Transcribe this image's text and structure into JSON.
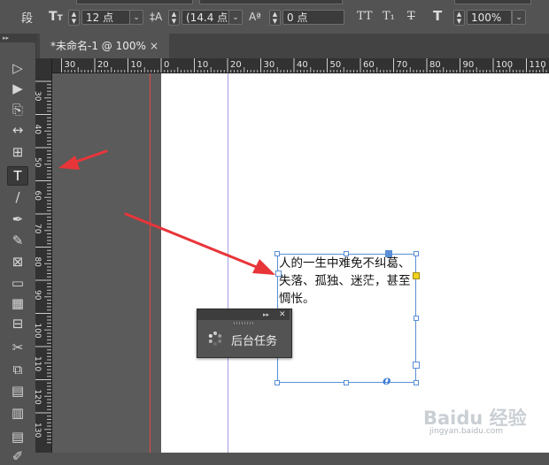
{
  "control_bar": {
    "paragraph_char": "段",
    "font_size_value": "12 点",
    "leading_value": "(14.4 点",
    "tracking_value": "0 点",
    "zoom_value": "100%",
    "font_size_icon": "font-size-icon",
    "leading_icon": "leading-icon",
    "tracking_icon": "tracking-icon",
    "all_caps_label": "TT",
    "subscript_label": "T₁",
    "strikethrough_label": "T"
  },
  "document_tab": {
    "title": "*未命名-1 @ 100%",
    "close_glyph": "×"
  },
  "tools_panel": {
    "collapse_glyph": "▸▸",
    "tools": [
      {
        "name": "selection-tool-icon",
        "glyph": "▷"
      },
      {
        "name": "direct-selection-tool-icon",
        "glyph": "▶"
      },
      {
        "name": "page-tool-icon",
        "glyph": "⎘"
      },
      {
        "name": "gap-tool-icon",
        "glyph": "↔"
      },
      {
        "name": "content-collector-icon",
        "glyph": "⊞"
      },
      {
        "name": "type-tool-icon",
        "glyph": "T"
      },
      {
        "name": "line-tool-icon",
        "glyph": "/"
      },
      {
        "name": "pen-tool-icon",
        "glyph": "✒"
      },
      {
        "name": "pencil-tool-icon",
        "glyph": "✎"
      },
      {
        "name": "rectangle-frame-tool-icon",
        "glyph": "⊠"
      },
      {
        "name": "rectangle-tool-icon",
        "glyph": "▭"
      },
      {
        "name": "table-tool-icon",
        "glyph": "▦"
      },
      {
        "name": "grid-tool-icon",
        "glyph": "⊟"
      },
      {
        "name": "scissors-tool-icon",
        "glyph": "✂"
      },
      {
        "name": "free-transform-tool-icon",
        "glyph": "⧉"
      },
      {
        "name": "gradient-swatch-tool-icon",
        "glyph": "▤"
      },
      {
        "name": "gradient-feather-tool-icon",
        "glyph": "▥"
      },
      {
        "name": "note-tool-icon",
        "glyph": "▤"
      },
      {
        "name": "eyedropper-tool-icon",
        "glyph": "✐"
      }
    ]
  },
  "horizontal_ruler": {
    "labels": [
      "30",
      "20",
      "10",
      "0",
      "10",
      "20",
      "30",
      "40",
      "50",
      "60",
      "70",
      "80",
      "90",
      "100",
      "110"
    ]
  },
  "vertical_ruler": {
    "labels": [
      "30",
      "40",
      "50",
      "60",
      "70",
      "80",
      "90",
      "100",
      "110",
      "120",
      "130"
    ]
  },
  "text_frame": {
    "content": "人的一生中难免不纠葛、失落、孤独、迷茫，甚至惆怅。",
    "overset_glyph": "o"
  },
  "background_tasks_panel": {
    "title": "后台任务",
    "collapse_glyph": "▸▸",
    "close_glyph": "✕"
  },
  "watermark": {
    "logo": "Baidu 经验",
    "url": "jingyan.baidu.com"
  },
  "colors": {
    "arrow": "#e8353a",
    "bleed_guide": "#e04848",
    "margin_guide": "#a59de6",
    "frame_border": "#5a8fd6"
  }
}
